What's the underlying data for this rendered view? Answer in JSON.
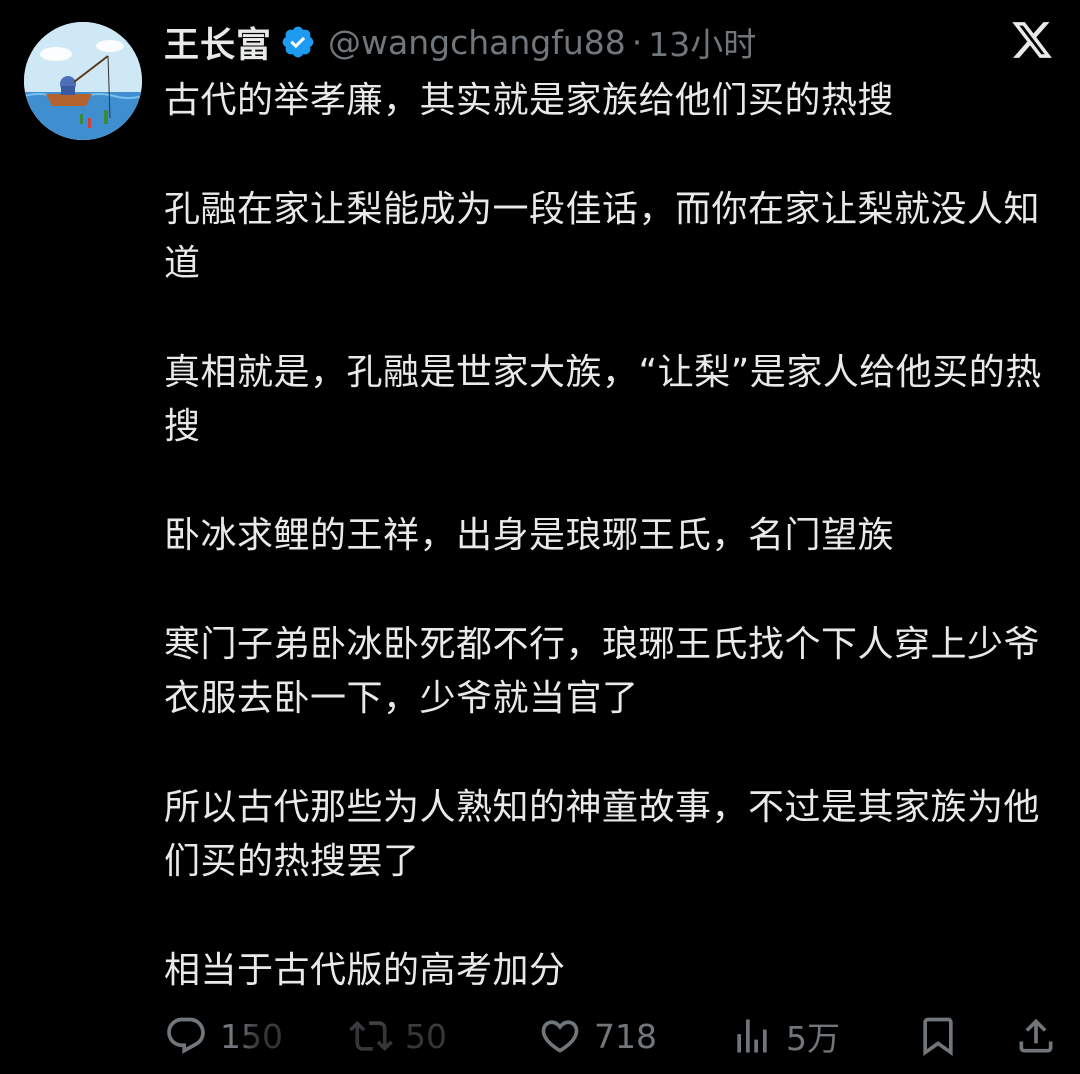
{
  "tweet": {
    "display_name": "王长富",
    "handle": "@wangchangfu88",
    "separator": "·",
    "timestamp": "13小时",
    "paragraphs": [
      "古代的举孝廉，其实就是家族给他们买的热搜",
      "孔融在家让梨能成为一段佳话，而你在家让梨就没人知道",
      "真相就是，孔融是世家大族，“让梨”是家人给他买的热搜",
      "卧冰求鲤的王祥，出身是琅琊王氏，名门望族",
      "寒门子弟卧冰卧死都不行，琅琊王氏找个下人穿上少爷衣服去卧一下，少爷就当官了",
      "所以古代那些为人熟知的神童故事，不过是其家族为他们买的热搜罢了",
      "相当于古代版的高考加分"
    ]
  },
  "actions": {
    "reply_count": "150",
    "retweet_count": "50",
    "like_count": "718",
    "views_count": "5万"
  },
  "icons": {
    "avatar": "fisherman-avatar",
    "verified": "verified-badge-icon",
    "brand": "x-logo-icon",
    "reply": "reply-icon",
    "retweet": "retweet-icon",
    "like": "heart-icon",
    "views": "views-chart-icon",
    "bookmark": "bookmark-icon",
    "share": "share-icon"
  },
  "colors": {
    "background": "#000000",
    "text": "#e7e9ea",
    "muted": "#71767b",
    "verified": "#1d9bf0"
  }
}
